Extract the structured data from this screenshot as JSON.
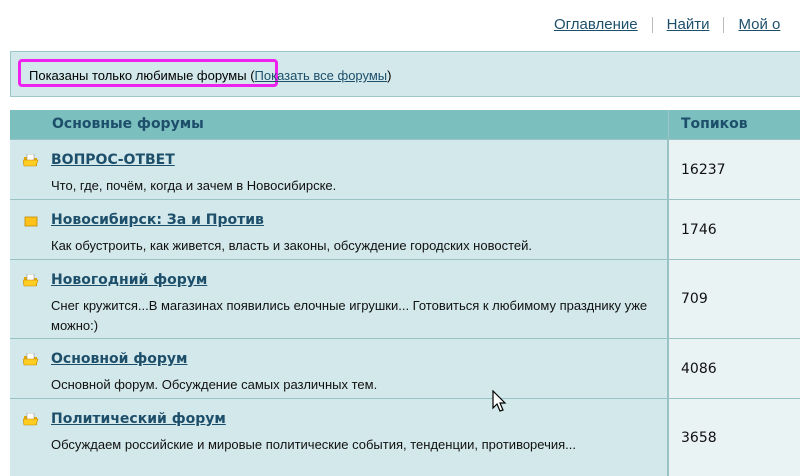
{
  "nav": {
    "items": [
      "Оглавление",
      "Найти",
      "Мой о"
    ]
  },
  "info": {
    "text": "Показаны только любимые форумы",
    "open": "(",
    "link": "Показать все форумы",
    "close": ")"
  },
  "table": {
    "col_forum": "Основные форумы",
    "col_topics": "Топиков",
    "rows": [
      {
        "title": "ВОПРОС-ОТВЕТ",
        "desc": "Что, где, почём, когда и зачем в Новосибирске.",
        "topics": "16237",
        "icon": "folder-open-icon"
      },
      {
        "title": "Новосибирск: За и Против",
        "desc": "Как обустроить, как живется, власть и законы, обсуждение городских новостей.",
        "topics": "1746",
        "icon": "folder-icon"
      },
      {
        "title": "Новогодний форум",
        "desc": "Снег кружится...В магазинах появились елочные игрушки... Готовиться к любимому празднику уже можно:)",
        "topics": "709",
        "icon": "folder-open-icon"
      },
      {
        "title": "Основной форум",
        "desc": "Основной форум. Обсуждение самых различных тем.",
        "topics": "4086",
        "icon": "folder-open-icon"
      },
      {
        "title": "Политический форум",
        "desc": "Обсуждаем российские и мировые политические события, тенденции, противоречия...",
        "topics": "3658",
        "icon": "folder-open-icon"
      }
    ]
  },
  "colors": {
    "header": "#7bbfbf",
    "row": "#d2e8ea",
    "link": "#1d4f6b",
    "highlight": "#ee22ee"
  }
}
